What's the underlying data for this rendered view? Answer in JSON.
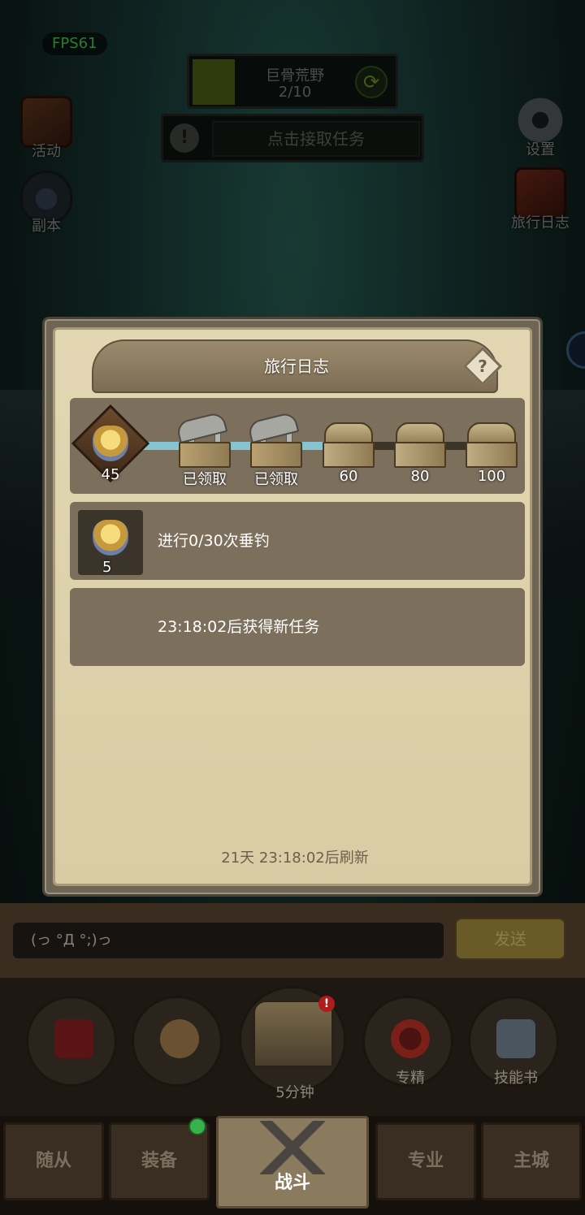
{
  "fps": "FPS61",
  "zone": {
    "name": "巨骨荒野",
    "progress": "2/10"
  },
  "task_button": {
    "label": "点击接取任务"
  },
  "side_buttons": {
    "activity": "活动",
    "dungeon": "副本",
    "settings": "设置",
    "travel_log": "旅行日志"
  },
  "modal": {
    "title": "旅行日志",
    "help_symbol": "?",
    "level": "45",
    "track_progress": 0.52,
    "milestones": [
      {
        "label": "已领取",
        "state": "claimed"
      },
      {
        "label": "已领取",
        "state": "claimed"
      },
      {
        "label": "60",
        "state": "locked"
      },
      {
        "label": "80",
        "state": "locked"
      },
      {
        "label": "100",
        "state": "locked"
      }
    ],
    "task": {
      "reward_count": "5",
      "text": "进行0/30次垂钓"
    },
    "next_task": {
      "text": "23:18:02后获得新任务"
    },
    "refresh_note": "21天 23:18:02后刷新"
  },
  "chat": {
    "input_value": "(っ °Д °;)っ",
    "send_label": "发送"
  },
  "actions": {
    "chest_timer": "5分钟",
    "specialization": "专精",
    "skill_book": "技能书",
    "alert_badge": "!"
  },
  "nav": {
    "followers": "随从",
    "equipment": "装备",
    "battle": "战斗",
    "profession": "专业",
    "main_city": "主城"
  },
  "colors": {
    "panel_bg": "#ddd0aa",
    "panel_row": "#7c6f5c",
    "track_fill": "#86c4d2",
    "fps_green": "#4fe05a"
  }
}
